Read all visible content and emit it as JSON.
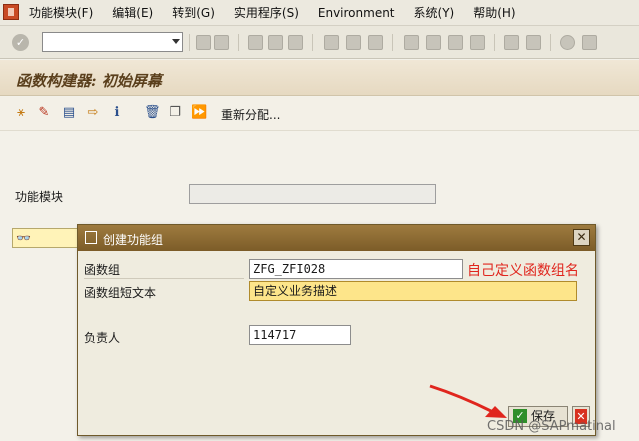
{
  "menu": {
    "items": [
      {
        "label": "功能模块(F)"
      },
      {
        "label": "编辑(E)"
      },
      {
        "label": "转到(G)"
      },
      {
        "label": "实用程序(S)"
      },
      {
        "label": "Environment"
      },
      {
        "label": "系统(Y)"
      },
      {
        "label": "帮助(H)"
      }
    ]
  },
  "screen": {
    "title": "函数构建器: 初始屏幕"
  },
  "app_toolbar": {
    "reassign_label": "重新分配..."
  },
  "main": {
    "function_module_label": "功能模块",
    "function_module_value": ""
  },
  "dialog": {
    "title": "创建功能组",
    "rows": [
      {
        "label": "函数组",
        "value": "ZFG_ZFI028"
      },
      {
        "label": "函数组短文本",
        "value": "自定义业务描述"
      },
      {
        "label": "负责人",
        "value": "114717"
      }
    ],
    "annotation": "自己定义函数组名",
    "annotation_color": "#e0261e",
    "save_label": "保存",
    "cancel_icon": "cancel-x-icon"
  },
  "watermark": "CSDN @SAPmatinal",
  "colors": {
    "title_bar": "#e6d9c1",
    "dialog_header": "#7c5c28",
    "active_field": "#fde58a",
    "save_green": "#2f8f2a",
    "cancel_red": "#d8311f"
  }
}
